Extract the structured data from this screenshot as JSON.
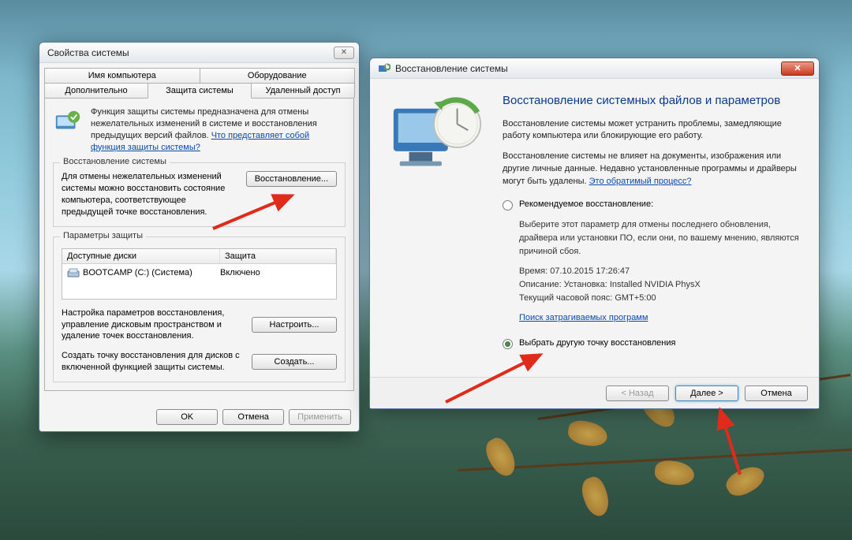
{
  "props": {
    "title": "Свойства системы",
    "tabs_row1": [
      "Имя компьютера",
      "Оборудование"
    ],
    "tabs_row2": [
      "Дополнительно",
      "Защита системы",
      "Удаленный доступ"
    ],
    "active_tab": "Защита системы",
    "intro": "Функция защиты системы предназначена для отмены нежелательных изменений в системе и восстановления предыдущих версий файлов.",
    "intro_link": "Что представляет собой функция защиты системы?",
    "section_restore": {
      "label": "Восстановление системы",
      "text": "Для отмены нежелательных изменений системы можно восстановить состояние компьютера, соответствующее предыдущей точке восстановления.",
      "button": "Восстановление..."
    },
    "section_params": {
      "label": "Параметры защиты",
      "col1": "Доступные диски",
      "col2": "Защита",
      "rows": [
        {
          "name": "BOOTCAMP (C:) (Система)",
          "protection": "Включено"
        }
      ],
      "configure_text": "Настройка параметров восстановления, управление дисковым пространством и удаление точек восстановления.",
      "configure_btn": "Настроить...",
      "create_text": "Создать точку восстановления для дисков с включенной функцией защиты системы.",
      "create_btn": "Создать..."
    },
    "buttons": {
      "ok": "OK",
      "cancel": "Отмена",
      "apply": "Применить"
    }
  },
  "restore": {
    "title": "Восстановление системы",
    "heading": "Восстановление системных файлов и параметров",
    "para1": "Восстановление системы может устранить проблемы, замедляющие работу компьютера или блокирующие его работу.",
    "para2": "Восстановление системы не влияет на документы, изображения или другие личные данные. Недавно установленные программы и драйверы могут быть удалены.",
    "para2_link": "Это обратимый процесс?",
    "radio_recommended": {
      "label": "Рекомендуемое восстановление:",
      "detail": "Выберите этот параметр для отмены последнего обновления, драйвера или установки ПО, если они, по вашему мнению, являются причиной сбоя.",
      "time_label": "Время:",
      "time_value": "07.10.2015 17:26:47",
      "desc_label": "Описание:",
      "desc_value": "Установка: Installed NVIDIA PhysX",
      "tz_label": "Текущий часовой пояс:",
      "tz_value": "GMT+5:00",
      "scan_link": "Поиск затрагиваемых программ"
    },
    "radio_other": {
      "label": "Выбрать другую точку восстановления"
    },
    "buttons": {
      "back": "< Назад",
      "next": "Далее >",
      "cancel": "Отмена"
    }
  }
}
